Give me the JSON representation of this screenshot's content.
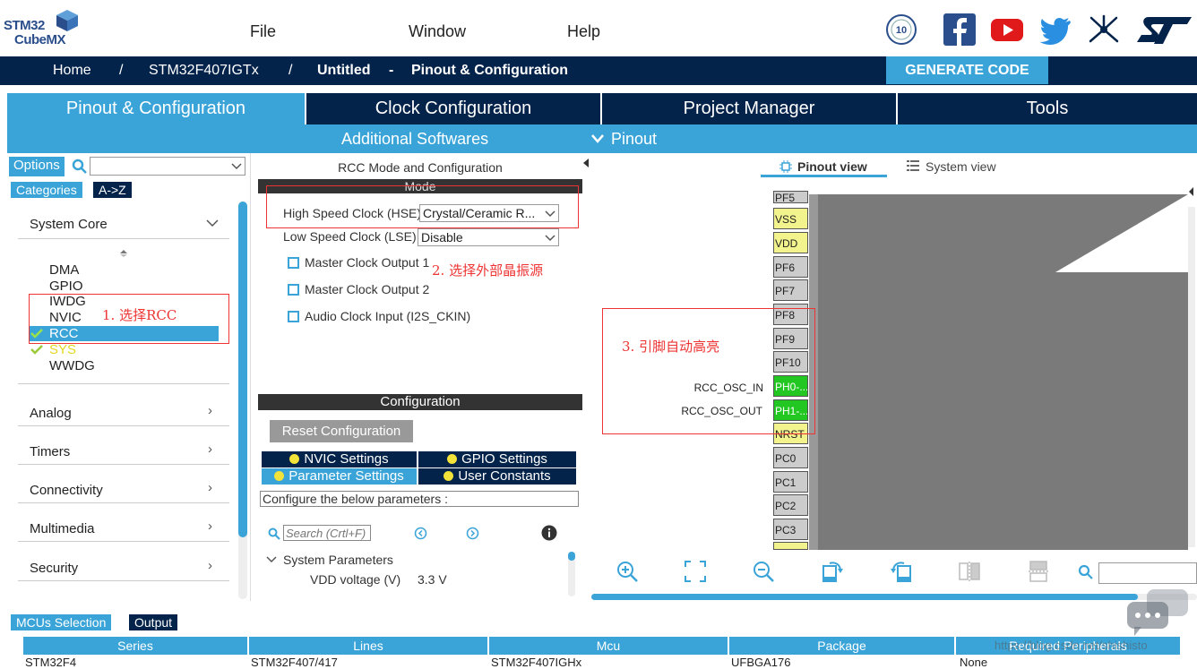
{
  "app": {
    "logo_line1": "STM32",
    "logo_line2": "CubeMX"
  },
  "menu": [
    "File",
    "Window",
    "Help"
  ],
  "social": {
    "anniversary": "10"
  },
  "breadcrumb": {
    "home": "Home",
    "sep": "/",
    "mcu": "STM32F407IGTx",
    "project": "Untitled",
    "dash": "-",
    "view": "Pinout & Configuration"
  },
  "generate_label": "GENERATE CODE",
  "tabs": [
    "Pinout & Configuration",
    "Clock Configuration",
    "Project Manager",
    "Tools"
  ],
  "subtabs": {
    "additional": "Additional Softwares",
    "pinout": "Pinout",
    "chevron": "⌵"
  },
  "left": {
    "options_label": "Options",
    "search_value": "",
    "categories_label": "Categories",
    "az_label": "A->Z",
    "system_core": "System Core",
    "items": [
      "DMA",
      "GPIO",
      "IWDG",
      "NVIC",
      "RCC",
      "SYS",
      "WWDG"
    ],
    "selected_item": "RCC",
    "sections": [
      "Analog",
      "Timers",
      "Connectivity",
      "Multimedia",
      "Security"
    ]
  },
  "rcc": {
    "title": "RCC Mode and Configuration",
    "mode_label": "Mode",
    "hse_label": "High Speed Clock (HSE)",
    "hse_value": "Crystal/Ceramic R...",
    "lse_label": "Low Speed Clock (LSE)",
    "lse_value": "Disable",
    "mco1": "Master Clock Output 1",
    "mco2": "Master Clock Output 2",
    "i2s": "Audio Clock Input (I2S_CKIN)"
  },
  "config": {
    "header": "Configuration",
    "reset": "Reset Configuration",
    "nvic": "NVIC Settings",
    "gpio": "GPIO Settings",
    "param": "Parameter Settings",
    "user": "User Constants",
    "hint": "Configure the below parameters :",
    "search_placeholder": "Search (Crtl+F)",
    "group": "System Parameters",
    "vdd_label": "VDD voltage (V)",
    "vdd_value": "3.3 V"
  },
  "pinout": {
    "pinout_view": "Pinout view",
    "system_view": "System view",
    "pins": [
      "PF5",
      "VSS",
      "VDD",
      "PF6",
      "PF7",
      "PF8",
      "PF9",
      "PF10",
      "PH0-...",
      "PH1-...",
      "NRST",
      "PC0",
      "PC1",
      "PC2",
      "PC3",
      ""
    ],
    "osc_in": "RCC_OSC_IN",
    "osc_out": "RCC_OSC_OUT"
  },
  "notes": {
    "n1": "1. 选择RCC",
    "n2": "2. 选择外部晶振源",
    "n3": "3. 引脚自动高亮"
  },
  "bottom": {
    "mcus_tab": "MCUs Selection",
    "output_tab": "Output",
    "columns": [
      "Series",
      "Lines",
      "Mcu",
      "Package",
      "Required Peripherals"
    ],
    "row": [
      "STM32F4",
      "STM32F407/417",
      "STM32F407IGHx",
      "UFBGA176",
      "None"
    ],
    "watermark": "https://blog.csdn.net/shishisto"
  },
  "colors": {
    "accent": "#3aa4d8",
    "navy": "#03234b",
    "annotation": "#e33333"
  }
}
